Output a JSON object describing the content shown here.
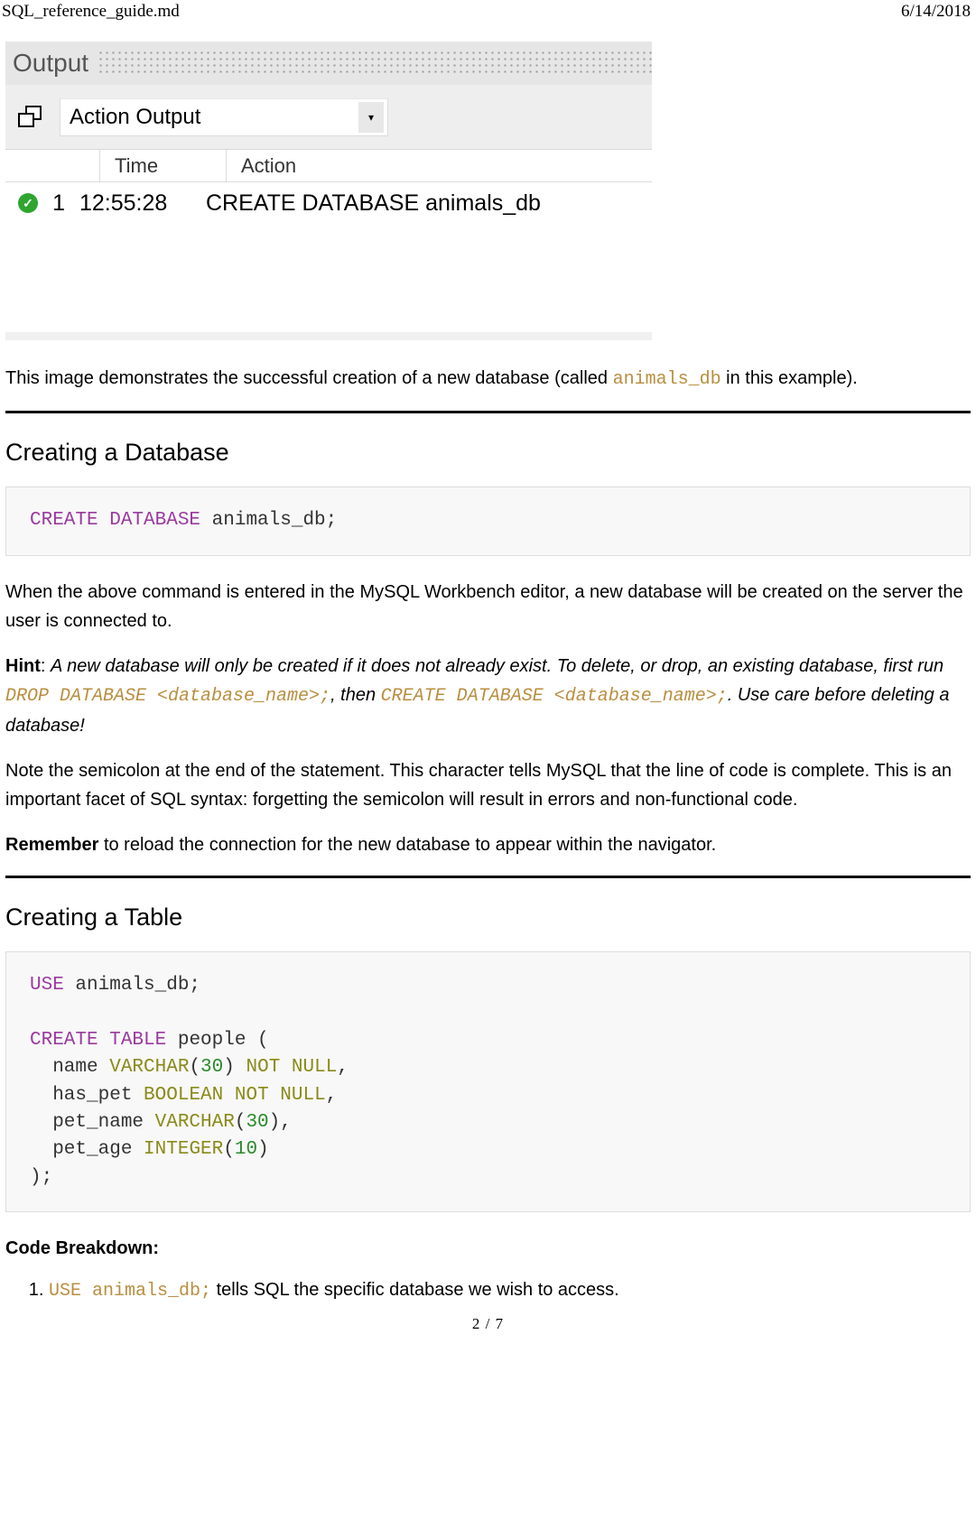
{
  "header": {
    "filename": "SQL_reference_guide.md",
    "date": "6/14/2018"
  },
  "workbench": {
    "output_label": "Output",
    "select_value": "Action Output",
    "dropdown_glyph": "▾",
    "col_time": "Time",
    "col_action": "Action",
    "row": {
      "check": "✓",
      "index": "1",
      "time": "12:55:28",
      "action": "CREATE DATABASE animals_db"
    }
  },
  "intro": {
    "part1": "This image demonstrates the successful creation of a new database (called ",
    "code": "animals_db",
    "part2": " in this example)."
  },
  "sec1": {
    "heading": "Creating a Database",
    "code_kw": "CREATE DATABASE",
    "code_rest": " animals_db;",
    "p1": "When the above command is entered in the MySQL Workbench editor, a new database will be created on the server the user is connected to.",
    "hint_label": "Hint",
    "hint_sep": ": ",
    "hint_i1": "A new database will only be created if it does not already exist. To delete, or drop, an existing database, first run ",
    "hint_code1": "DROP DATABASE <database_name>;",
    "hint_i2": ", then ",
    "hint_code2": "CREATE DATABASE <database_name>;",
    "hint_i3": ". Use care before deleting a database!",
    "p2": "Note the semicolon at the end of the statement. This character tells MySQL that the line of code is complete. This is an important facet of SQL syntax: forgetting the semicolon will result in errors and non-functional code.",
    "rem_label": "Remember",
    "rem_rest": " to reload the connection for the new database to appear within the navigator."
  },
  "sec2": {
    "heading": "Creating a Table",
    "code": {
      "l1a": "USE",
      "l1b": " animals_db;",
      "l3a": "CREATE TABLE",
      "l3b": " people (",
      "l4a": "  name ",
      "l4b": "VARCHAR",
      "l4c": "(",
      "l4d": "30",
      "l4e": ") ",
      "l4f": "NOT NULL",
      "l4g": ",",
      "l5a": "  has_pet ",
      "l5b": "BOOLEAN",
      "l5c": " ",
      "l5d": "NOT NULL",
      "l5e": ",",
      "l6a": "  pet_name ",
      "l6b": "VARCHAR",
      "l6c": "(",
      "l6d": "30",
      "l6e": "),",
      "l7a": "  pet_age ",
      "l7b": "INTEGER",
      "l7c": "(",
      "l7d": "10",
      "l7e": ")",
      "l8": ");"
    },
    "breakdown_h": "Code Breakdown:",
    "li1_code": "USE animals_db;",
    "li1_rest": " tells SQL the specific database we wish to access."
  },
  "footer": {
    "page": "2 / 7"
  }
}
